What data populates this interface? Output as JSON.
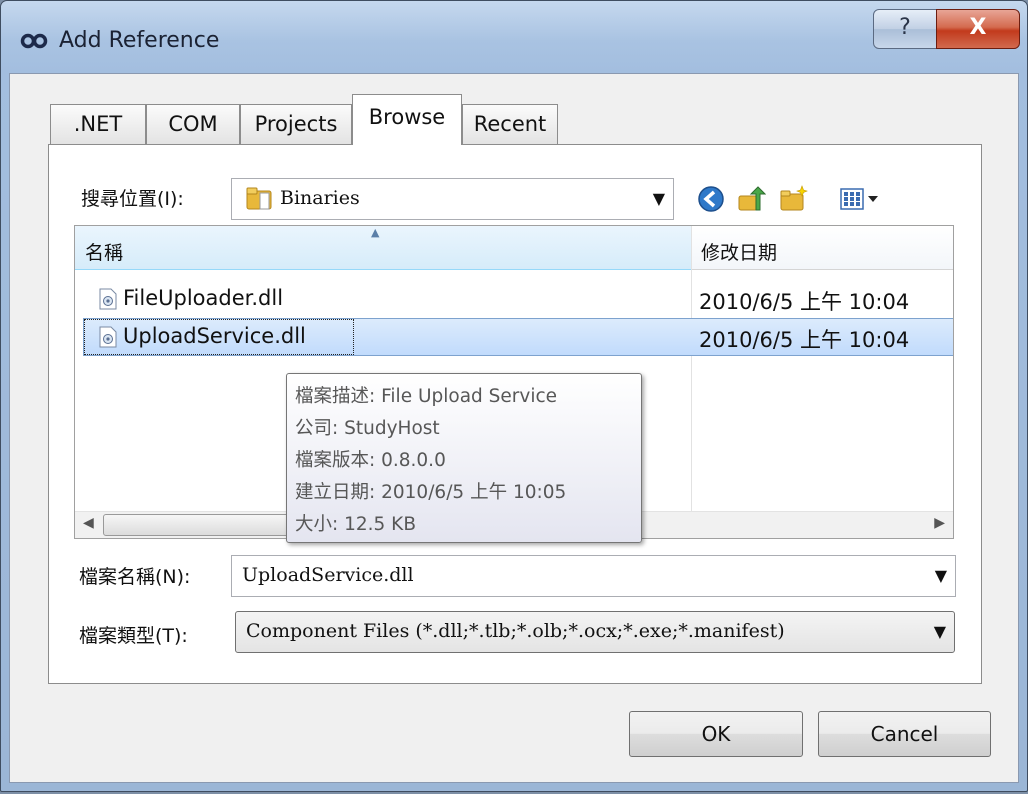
{
  "window": {
    "title": "Add Reference",
    "help_label": "?",
    "close_label": "X"
  },
  "tabs": [
    {
      "label": ".NET"
    },
    {
      "label": "COM"
    },
    {
      "label": "Projects"
    },
    {
      "label": "Browse"
    },
    {
      "label": "Recent"
    }
  ],
  "look_in": {
    "label": "搜尋位置(I):",
    "value": "Binaries"
  },
  "file_list": {
    "columns": [
      "名稱",
      "修改日期"
    ],
    "rows": [
      {
        "name": "FileUploader.dll",
        "modified": "2010/6/5 上午 10:04"
      },
      {
        "name": "UploadService.dll",
        "modified": "2010/6/5 上午 10:04"
      }
    ]
  },
  "tooltip": {
    "lines": [
      "檔案描述: File Upload Service",
      "公司: StudyHost",
      "檔案版本: 0.8.0.0",
      "建立日期: 2010/6/5 上午 10:05",
      "大小: 12.5 KB"
    ]
  },
  "file_name": {
    "label": "檔案名稱(N):",
    "value": "UploadService.dll"
  },
  "file_type": {
    "label": "檔案類型(T):",
    "value": "Component Files (*.dll;*.tlb;*.olb;*.ocx;*.exe;*.manifest)"
  },
  "buttons": {
    "ok": "OK",
    "cancel": "Cancel"
  },
  "colors": {
    "selection": "#c1dbfc",
    "title_bar": "#a9c3e2",
    "close_button": "#c23a1c"
  }
}
